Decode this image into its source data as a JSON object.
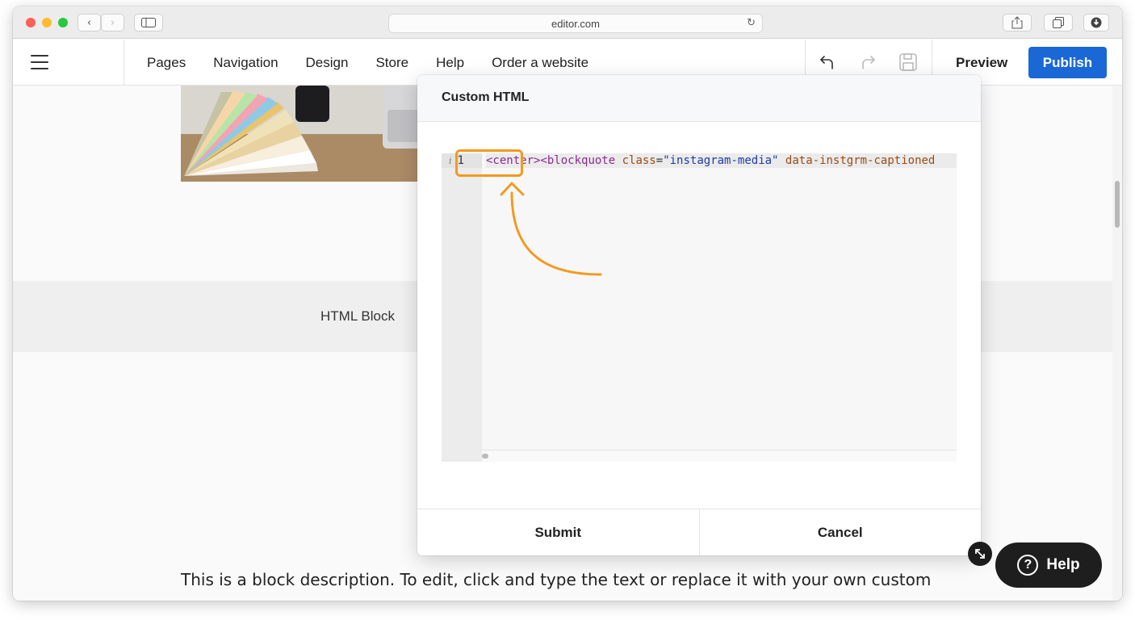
{
  "browser": {
    "url": "editor.com",
    "back_glyph": "‹",
    "forward_glyph": "›",
    "reload_glyph": "↻"
  },
  "toolbar": {
    "menu": [
      "Pages",
      "Navigation",
      "Design",
      "Store",
      "Help",
      "Order a website"
    ],
    "undo_icon": "undo-arrow-icon",
    "redo_icon": "redo-arrow-icon",
    "save_icon": "floppy-disk-icon",
    "preview_label": "Preview",
    "publish_label": "Publish",
    "accent_color": "#1a67d6"
  },
  "page": {
    "html_block_label": "HTML Block",
    "description": "This is a block description. To edit, click and type the text or replace it with your own custom"
  },
  "modal": {
    "title": "Custom HTML",
    "editor": {
      "line_info_glyph": "i",
      "line_number": "1",
      "code_tokens": {
        "center_tag": "<center>",
        "blockquote_open": "<blockquote",
        "class_attr": "class",
        "equals": "=",
        "class_value": "\"instagram-media\"",
        "data_attr": "data-instgrm-captioned"
      }
    },
    "highlight_color": "#f39a1d",
    "submit_label": "Submit",
    "cancel_label": "Cancel"
  },
  "help_widget": {
    "label": "Help",
    "glyph": "?"
  }
}
